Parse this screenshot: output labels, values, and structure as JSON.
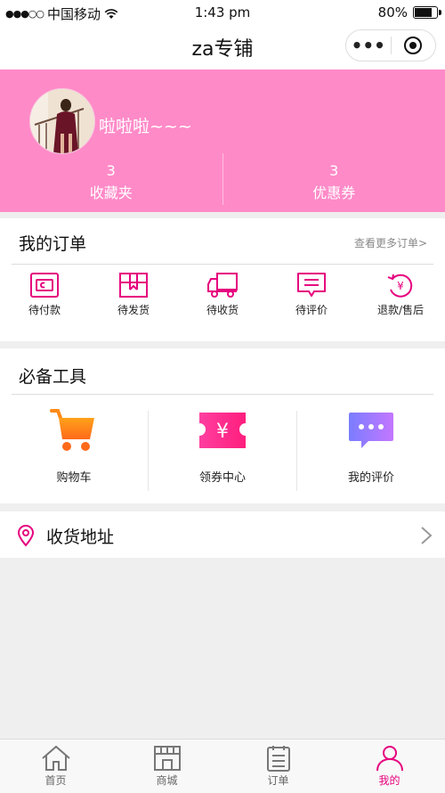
{
  "status_bar": {
    "carrier": "中国移动",
    "time": "1:43 pm",
    "battery": "80%",
    "battery_level": 0.8
  },
  "nav": {
    "title": "za专铺"
  },
  "colors": {
    "brand_pink": "#ff8ac8",
    "accent_magenta": "#e6007e"
  },
  "profile": {
    "username": "啦啦啦~~~",
    "stats": [
      {
        "num": "3",
        "label": "收藏夹"
      },
      {
        "num": "3",
        "label": "优惠券"
      }
    ]
  },
  "orders": {
    "title": "我的订单",
    "more_link": "查看更多订单>",
    "items": [
      {
        "label": "待付款",
        "icon": "wallet-icon"
      },
      {
        "label": "待发货",
        "icon": "package-icon"
      },
      {
        "label": "待收货",
        "icon": "truck-icon"
      },
      {
        "label": "待评价",
        "icon": "comment-icon"
      },
      {
        "label": "退款/售后",
        "icon": "refund-icon"
      }
    ]
  },
  "tools": {
    "title": "必备工具",
    "items": [
      {
        "label": "购物车",
        "icon": "cart-icon"
      },
      {
        "label": "领券中心",
        "icon": "coupon-icon"
      },
      {
        "label": "我的评价",
        "icon": "chat-bubble-icon"
      }
    ]
  },
  "address": {
    "label": "收货地址"
  },
  "tabbar": {
    "items": [
      {
        "label": "首页",
        "icon": "home-icon"
      },
      {
        "label": "商城",
        "icon": "store-icon"
      },
      {
        "label": "订单",
        "icon": "clipboard-icon"
      },
      {
        "label": "我的",
        "icon": "user-icon"
      }
    ],
    "active_index": 3
  }
}
